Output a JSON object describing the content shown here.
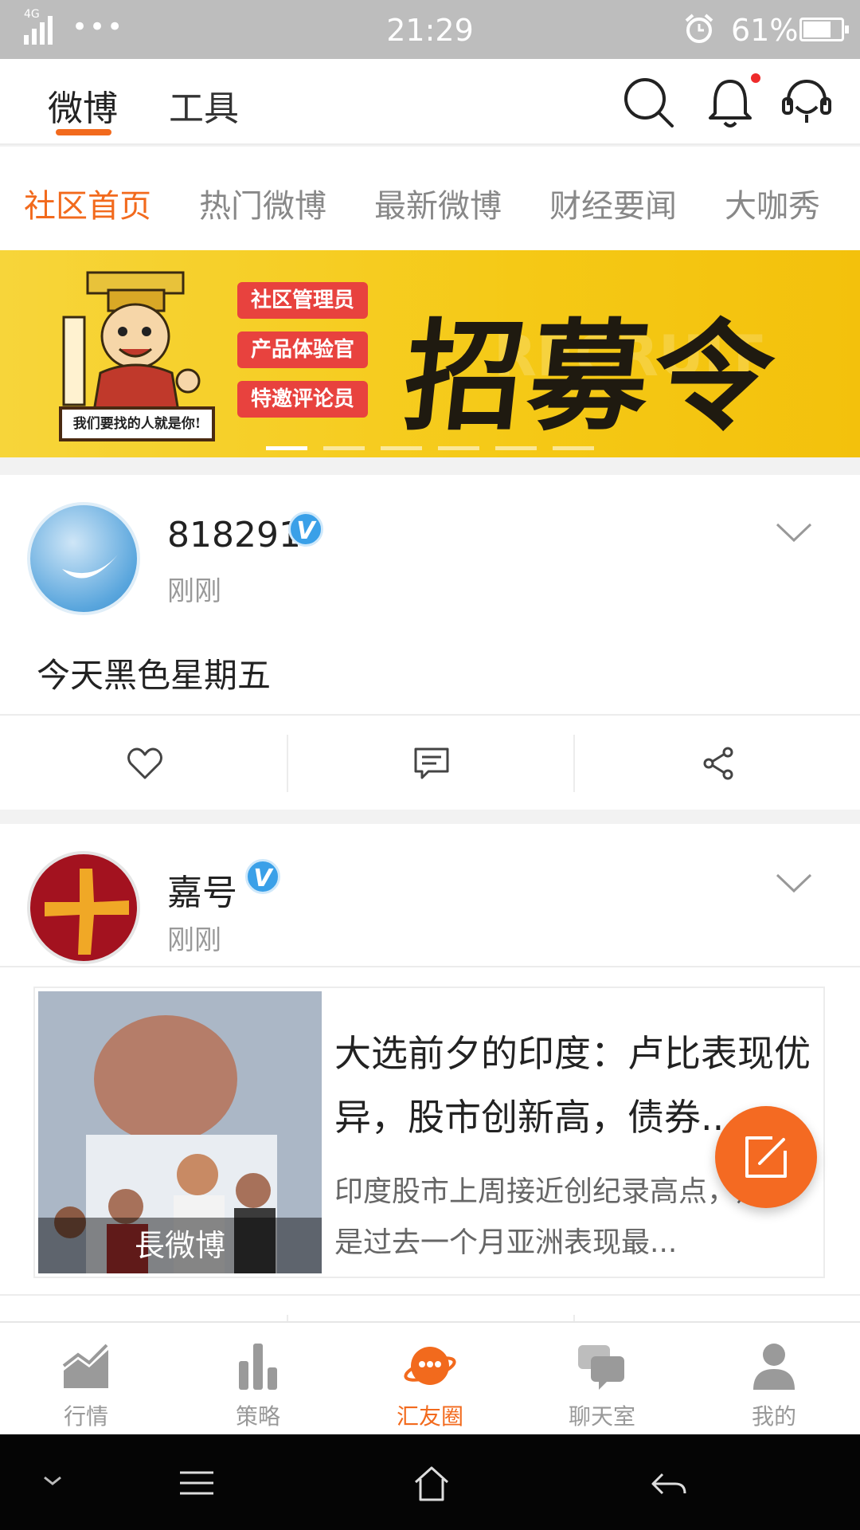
{
  "status_bar": {
    "network": "4G",
    "dots": "•••",
    "time": "21:29",
    "battery": "61%"
  },
  "header": {
    "tabs": [
      "微博",
      "工具"
    ],
    "active_tab": 0,
    "icons": [
      "search-icon",
      "bell-icon",
      "customer-service-icon"
    ],
    "accent_color": "#f26a1d"
  },
  "subnav": {
    "items": [
      "社区首页",
      "热门微博",
      "最新微博",
      "财经要闻",
      "大咖秀"
    ],
    "active": 0
  },
  "banner": {
    "tags": [
      "社区管理员",
      "产品体验官",
      "特邀评论员"
    ],
    "headline": "招募令",
    "watermark": "RECRUIT",
    "caption": "我们要找的人就是你!",
    "slide_count": 6,
    "active_slide": 0
  },
  "posts": [
    {
      "author": "818291",
      "verified": true,
      "time": "刚刚",
      "text": "今天黑色星期五"
    },
    {
      "author": "嘉号",
      "verified": true,
      "time": "刚刚",
      "article": {
        "title": "大选前夕的印度：卢比表现优异，股市创新高，债券...",
        "summary": "印度股市上周接近创纪录高点，卢比是过去一个月亚洲表现最...",
        "source": "長微博"
      }
    }
  ],
  "verified_badge": "V",
  "bottom_nav": {
    "items": [
      "行情",
      "策略",
      "汇友圈",
      "聊天室",
      "我的"
    ],
    "active": 2
  }
}
